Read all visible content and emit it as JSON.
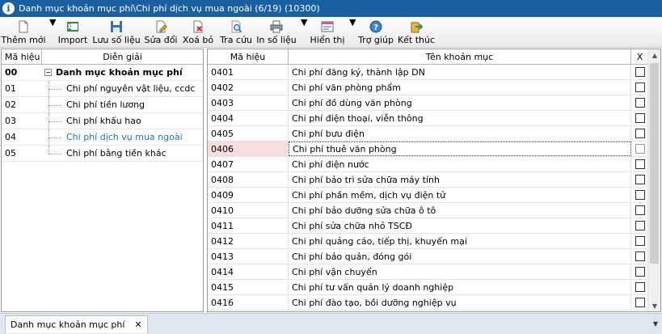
{
  "window": {
    "title": "Danh mục khoản mục phí\\Chi phí dịch vụ mua ngoài (6/19) (10300)"
  },
  "toolbar": {
    "buttons": [
      {
        "label": "Thêm mới",
        "icon": "new-document-icon"
      },
      {
        "label": "Import",
        "icon": "excel-import-icon"
      },
      {
        "label": "Lưu số liệu",
        "icon": "save-icon"
      },
      {
        "label": "Sửa đổi",
        "icon": "edit-icon"
      },
      {
        "label": "Xoá bỏ",
        "icon": "delete-icon"
      },
      {
        "label": "Tra cứu",
        "icon": "search-icon"
      },
      {
        "label": "In số liệu",
        "icon": "printer-icon"
      },
      {
        "label": "Hiển thị",
        "icon": "display-icon"
      },
      {
        "label": "Trợ giúp",
        "icon": "help-icon"
      },
      {
        "label": "Kết thúc",
        "icon": "exit-icon"
      }
    ]
  },
  "tree": {
    "headers": {
      "code": "Mã hiệu",
      "desc": "Diễn giải"
    },
    "root": {
      "code": "00",
      "name": "Danh mục khoản mục phí"
    },
    "children": [
      {
        "code": "01",
        "name": "Chi phí nguyên vật liệu, ccdc"
      },
      {
        "code": "02",
        "name": "Chi phí tiền lương"
      },
      {
        "code": "03",
        "name": "Chi phí khấu hao"
      },
      {
        "code": "04",
        "name": "Chi phí dịch vụ mua ngoài"
      },
      {
        "code": "05",
        "name": "Chi phí bằng tiền khác"
      }
    ],
    "selected_code": "04"
  },
  "grid": {
    "headers": {
      "code": "Mã hiệu",
      "name": "Tên khoản mục",
      "check": "X"
    },
    "rows": [
      {
        "code": "0401",
        "name": "Chi phí đăng ký, thành lập DN"
      },
      {
        "code": "0402",
        "name": "Chi phí văn phòng phẩm"
      },
      {
        "code": "0403",
        "name": "Chi phí đồ dùng văn phòng"
      },
      {
        "code": "0404",
        "name": "Chi phí điện thoại, viễn thông"
      },
      {
        "code": "0405",
        "name": "Chi phí bưu điện"
      },
      {
        "code": "0406",
        "name": "Chi phí thuê văn phòng"
      },
      {
        "code": "0407",
        "name": "Chi phí điện nước"
      },
      {
        "code": "0408",
        "name": "Chi phí bảo trì sửa chữa máy tính"
      },
      {
        "code": "0409",
        "name": "Chi phí phần mềm, dịch vụ điện tử"
      },
      {
        "code": "0410",
        "name": "Chi phí bảo dưỡng sửa chữa ô tô"
      },
      {
        "code": "0411",
        "name": "Chi phí sửa chữa nhỏ TSCĐ"
      },
      {
        "code": "0412",
        "name": "Chi phí quảng cáo, tiếp thị, khuyến mại"
      },
      {
        "code": "0413",
        "name": "Chi phí bảo quản, đóng gói"
      },
      {
        "code": "0414",
        "name": "Chi phí vận chuyển"
      },
      {
        "code": "0415",
        "name": "Chi phí tư vấn quản lý doanh nghiệp"
      },
      {
        "code": "0416",
        "name": "Chi phí đào tạo, bồi dưỡng nghiệp vụ"
      }
    ],
    "selected_code": "0406"
  },
  "statusbar": {
    "tab_label": "Danh mục khoản mục phí",
    "close_glyph": "✕"
  },
  "colors": {
    "title_bg": "#1a5fa0",
    "selected_row_bg": "#f7dede",
    "selected_tree_text": "#1f6fbf"
  }
}
